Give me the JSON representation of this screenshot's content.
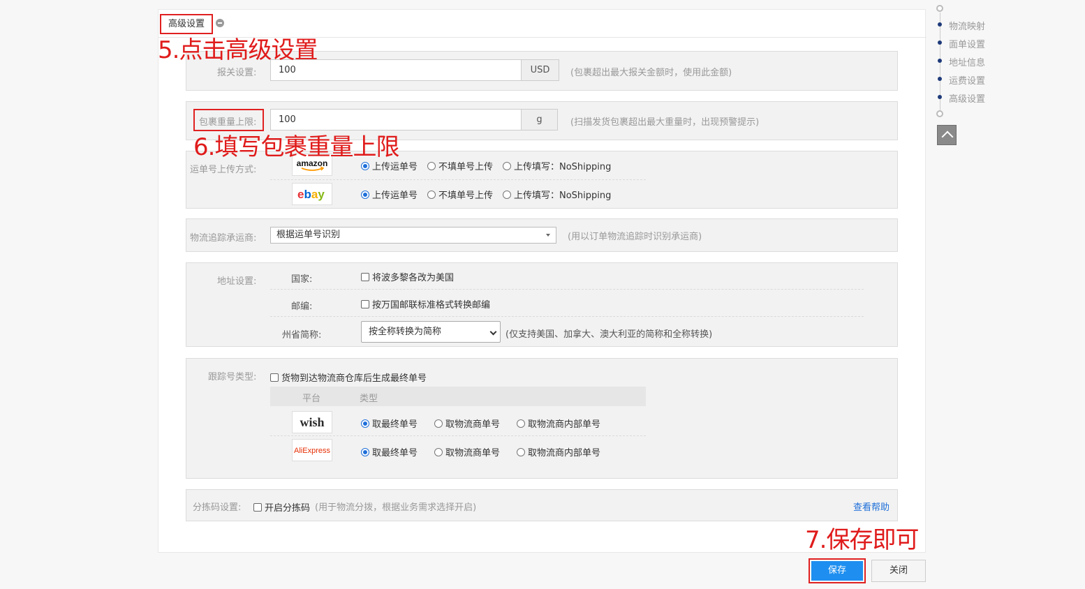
{
  "header": {
    "title": "高级设置"
  },
  "annotations": {
    "step5": "5.点击高级设置",
    "step6": "6.填写包裹重量上限",
    "step7": "7.保存即可"
  },
  "customs": {
    "label": "报关设置:",
    "value": "100",
    "unit": "USD",
    "hint": "(包裹超出最大报关金额时，使用此金额)"
  },
  "weight": {
    "label": "包裹重量上限:",
    "value": "100",
    "unit": "g",
    "hint": "(扫描发货包裹超出最大重量时，出现预警提示)"
  },
  "tracking_upload": {
    "label": "运单号上传方式:",
    "platforms": [
      {
        "logo": "amazon",
        "options": [
          "上传运单号",
          "不填单号上传",
          "上传填写：NoShipping"
        ],
        "selected": 0
      },
      {
        "logo": "ebay",
        "options": [
          "上传运单号",
          "不填单号上传",
          "上传填写：NoShipping"
        ],
        "selected": 0
      }
    ]
  },
  "carrier": {
    "label": "物流追踪承运商:",
    "value": "根据运单号识别",
    "hint": "(用以订单物流追踪时识别承运商)"
  },
  "address": {
    "label": "地址设置:",
    "country_label": "国家:",
    "country_option": "将波多黎各改为美国",
    "zip_label": "邮编:",
    "zip_option": "按万国邮联标准格式转换邮编",
    "state_label": "州省简称:",
    "state_value": "按全称转换为简称",
    "state_hint": "(仅支持美国、加拿大、澳大利亚的简称和全称转换)"
  },
  "tracking_type": {
    "label": "跟踪号类型:",
    "checkbox": "货物到达物流商仓库后生成最终单号",
    "col_platform": "平台",
    "col_type": "类型",
    "platforms": [
      {
        "logo": "wish",
        "options": [
          "取最终单号",
          "取物流商单号",
          "取物流商内部单号"
        ],
        "selected": 0
      },
      {
        "logo": "AliExpress",
        "options": [
          "取最终单号",
          "取物流商单号",
          "取物流商内部单号"
        ],
        "selected": 0
      }
    ]
  },
  "sorting": {
    "label": "分拣码设置:",
    "checkbox": "开启分拣码",
    "hint": "(用于物流分拨，根据业务需求选择开启)",
    "help": "查看帮助"
  },
  "buttons": {
    "save": "保存",
    "close": "关闭"
  },
  "side_nav": {
    "items": [
      "物流映射",
      "面单设置",
      "地址信息",
      "运费设置",
      "高级设置"
    ]
  },
  "colors": {
    "accent": "#1e8ff0",
    "annotation": "#e01b1b",
    "nav_dot": "#1e3a7a"
  }
}
